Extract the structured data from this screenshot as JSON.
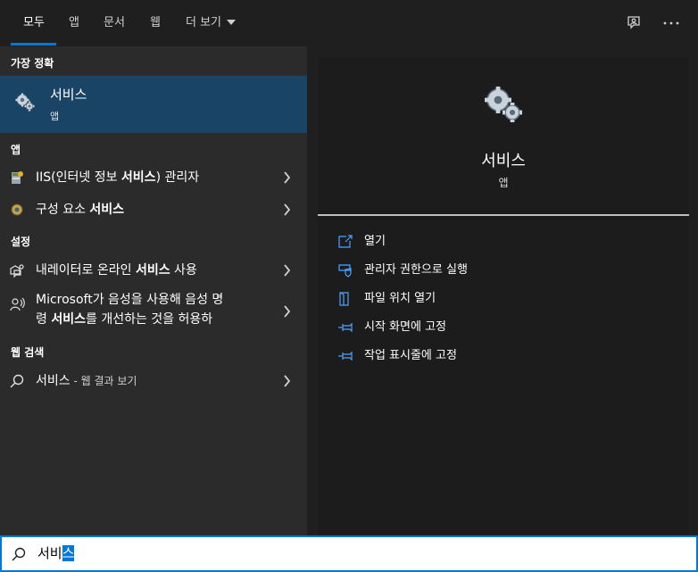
{
  "tabs": [
    {
      "label": "모두",
      "active": true
    },
    {
      "label": "앱"
    },
    {
      "label": "문서"
    },
    {
      "label": "웹"
    },
    {
      "label": "더 보기"
    }
  ],
  "top_icons": [
    "feedback-icon",
    "more-options-icon"
  ],
  "left": {
    "best_match_header": "가장 정확",
    "best_match": {
      "title": "서비스",
      "subtitle": "앱",
      "icon": "services-gear-icon"
    },
    "apps_header": "앱",
    "apps": [
      {
        "prefix": "IIS(인터넷 정보 ",
        "bold": "서비스",
        "suffix": ") 관리자",
        "icon": "iis-manager-icon"
      },
      {
        "prefix": "구성 요소 ",
        "bold": "서비스",
        "suffix": "",
        "icon": "component-services-icon"
      }
    ],
    "settings_header": "설정",
    "settings": [
      {
        "prefix": "내레이터로 온라인 ",
        "bold": "서비스",
        "suffix": " 사용",
        "icon": "narrator-icon"
      },
      {
        "line1": "Microsoft가 음성을 사용해 음성 명",
        "line2_prefix": "령 ",
        "line2_bold": "서비스",
        "line2_suffix": "를 개선하는 것을 허용하",
        "icon": "speech-icon"
      }
    ],
    "web_header": "웹 검색",
    "web": {
      "query": "서비스",
      "suffix": " - 웹 결과 보기",
      "icon": "search-icon"
    }
  },
  "right": {
    "title": "서비스",
    "subtitle": "앱",
    "icon": "services-gear-icon",
    "actions": [
      {
        "label": "열기",
        "icon": "open-icon"
      },
      {
        "label": "관리자 권한으로 실행",
        "icon": "shield-icon"
      },
      {
        "label": "파일 위치 열기",
        "icon": "file-location-icon"
      },
      {
        "label": "시작 화면에 고정",
        "icon": "pin-icon"
      },
      {
        "label": "작업 표시줄에 고정",
        "icon": "pin-taskbar-icon"
      }
    ]
  },
  "search": {
    "typed": "서비",
    "selected": "스"
  },
  "colors": {
    "accent": "#0078d7",
    "best_match_bg": "#1a4466",
    "left_bg": "#2b2b2b",
    "right_bg": "#1c1c1c"
  }
}
